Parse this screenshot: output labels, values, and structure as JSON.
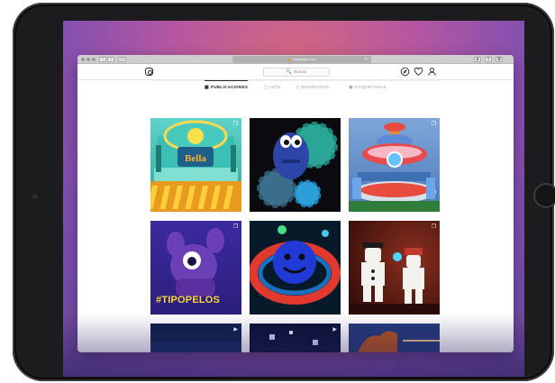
{
  "browser": {
    "url": "instagram.com",
    "reload_icon": "reload-icon",
    "colors": {
      "chrome": "#cfcdd0",
      "url_bar": "#b1afb2"
    }
  },
  "instagram": {
    "search_placeholder": "Buscar",
    "search_icon": "🔍",
    "nav_icons": [
      "explore-icon",
      "heart-icon",
      "profile-icon"
    ],
    "tabs": [
      {
        "label": "PUBLICACIONES",
        "icon": "grid-icon",
        "active": true
      },
      {
        "label": "IGTV",
        "icon": "igtv-icon",
        "active": false
      },
      {
        "label": "GUARDADAS",
        "icon": "bookmark-icon",
        "active": false
      },
      {
        "label": "ETIQUETADAS",
        "icon": "tag-icon",
        "active": false
      }
    ],
    "posts": [
      {
        "subject": "carousel-arcade-machine",
        "badge": "carousel-icon"
      },
      {
        "subject": "blue-gear-creature",
        "badge": ""
      },
      {
        "subject": "ufo-space-ride",
        "badge": "carousel-icon"
      },
      {
        "subject": "purple-tipopelos-creature",
        "badge": "carousel-icon",
        "caption": "#TIPOPELOS"
      },
      {
        "subject": "blue-smiley-ring",
        "badge": ""
      },
      {
        "subject": "pierrot-lego-figures",
        "badge": "carousel-icon"
      },
      {
        "subject": "night-scene",
        "badge": "video-icon"
      },
      {
        "subject": "dark-blue-scene",
        "badge": "video-icon"
      },
      {
        "subject": "rooftop-scene",
        "badge": ""
      }
    ],
    "colors": {
      "text": "#262626",
      "muted": "#8e8e8e",
      "border": "#dbdbdb"
    }
  },
  "screen": {
    "wallpaper_colors": [
      "#d96a7a",
      "#b457a2",
      "#7f4fb1"
    ]
  }
}
